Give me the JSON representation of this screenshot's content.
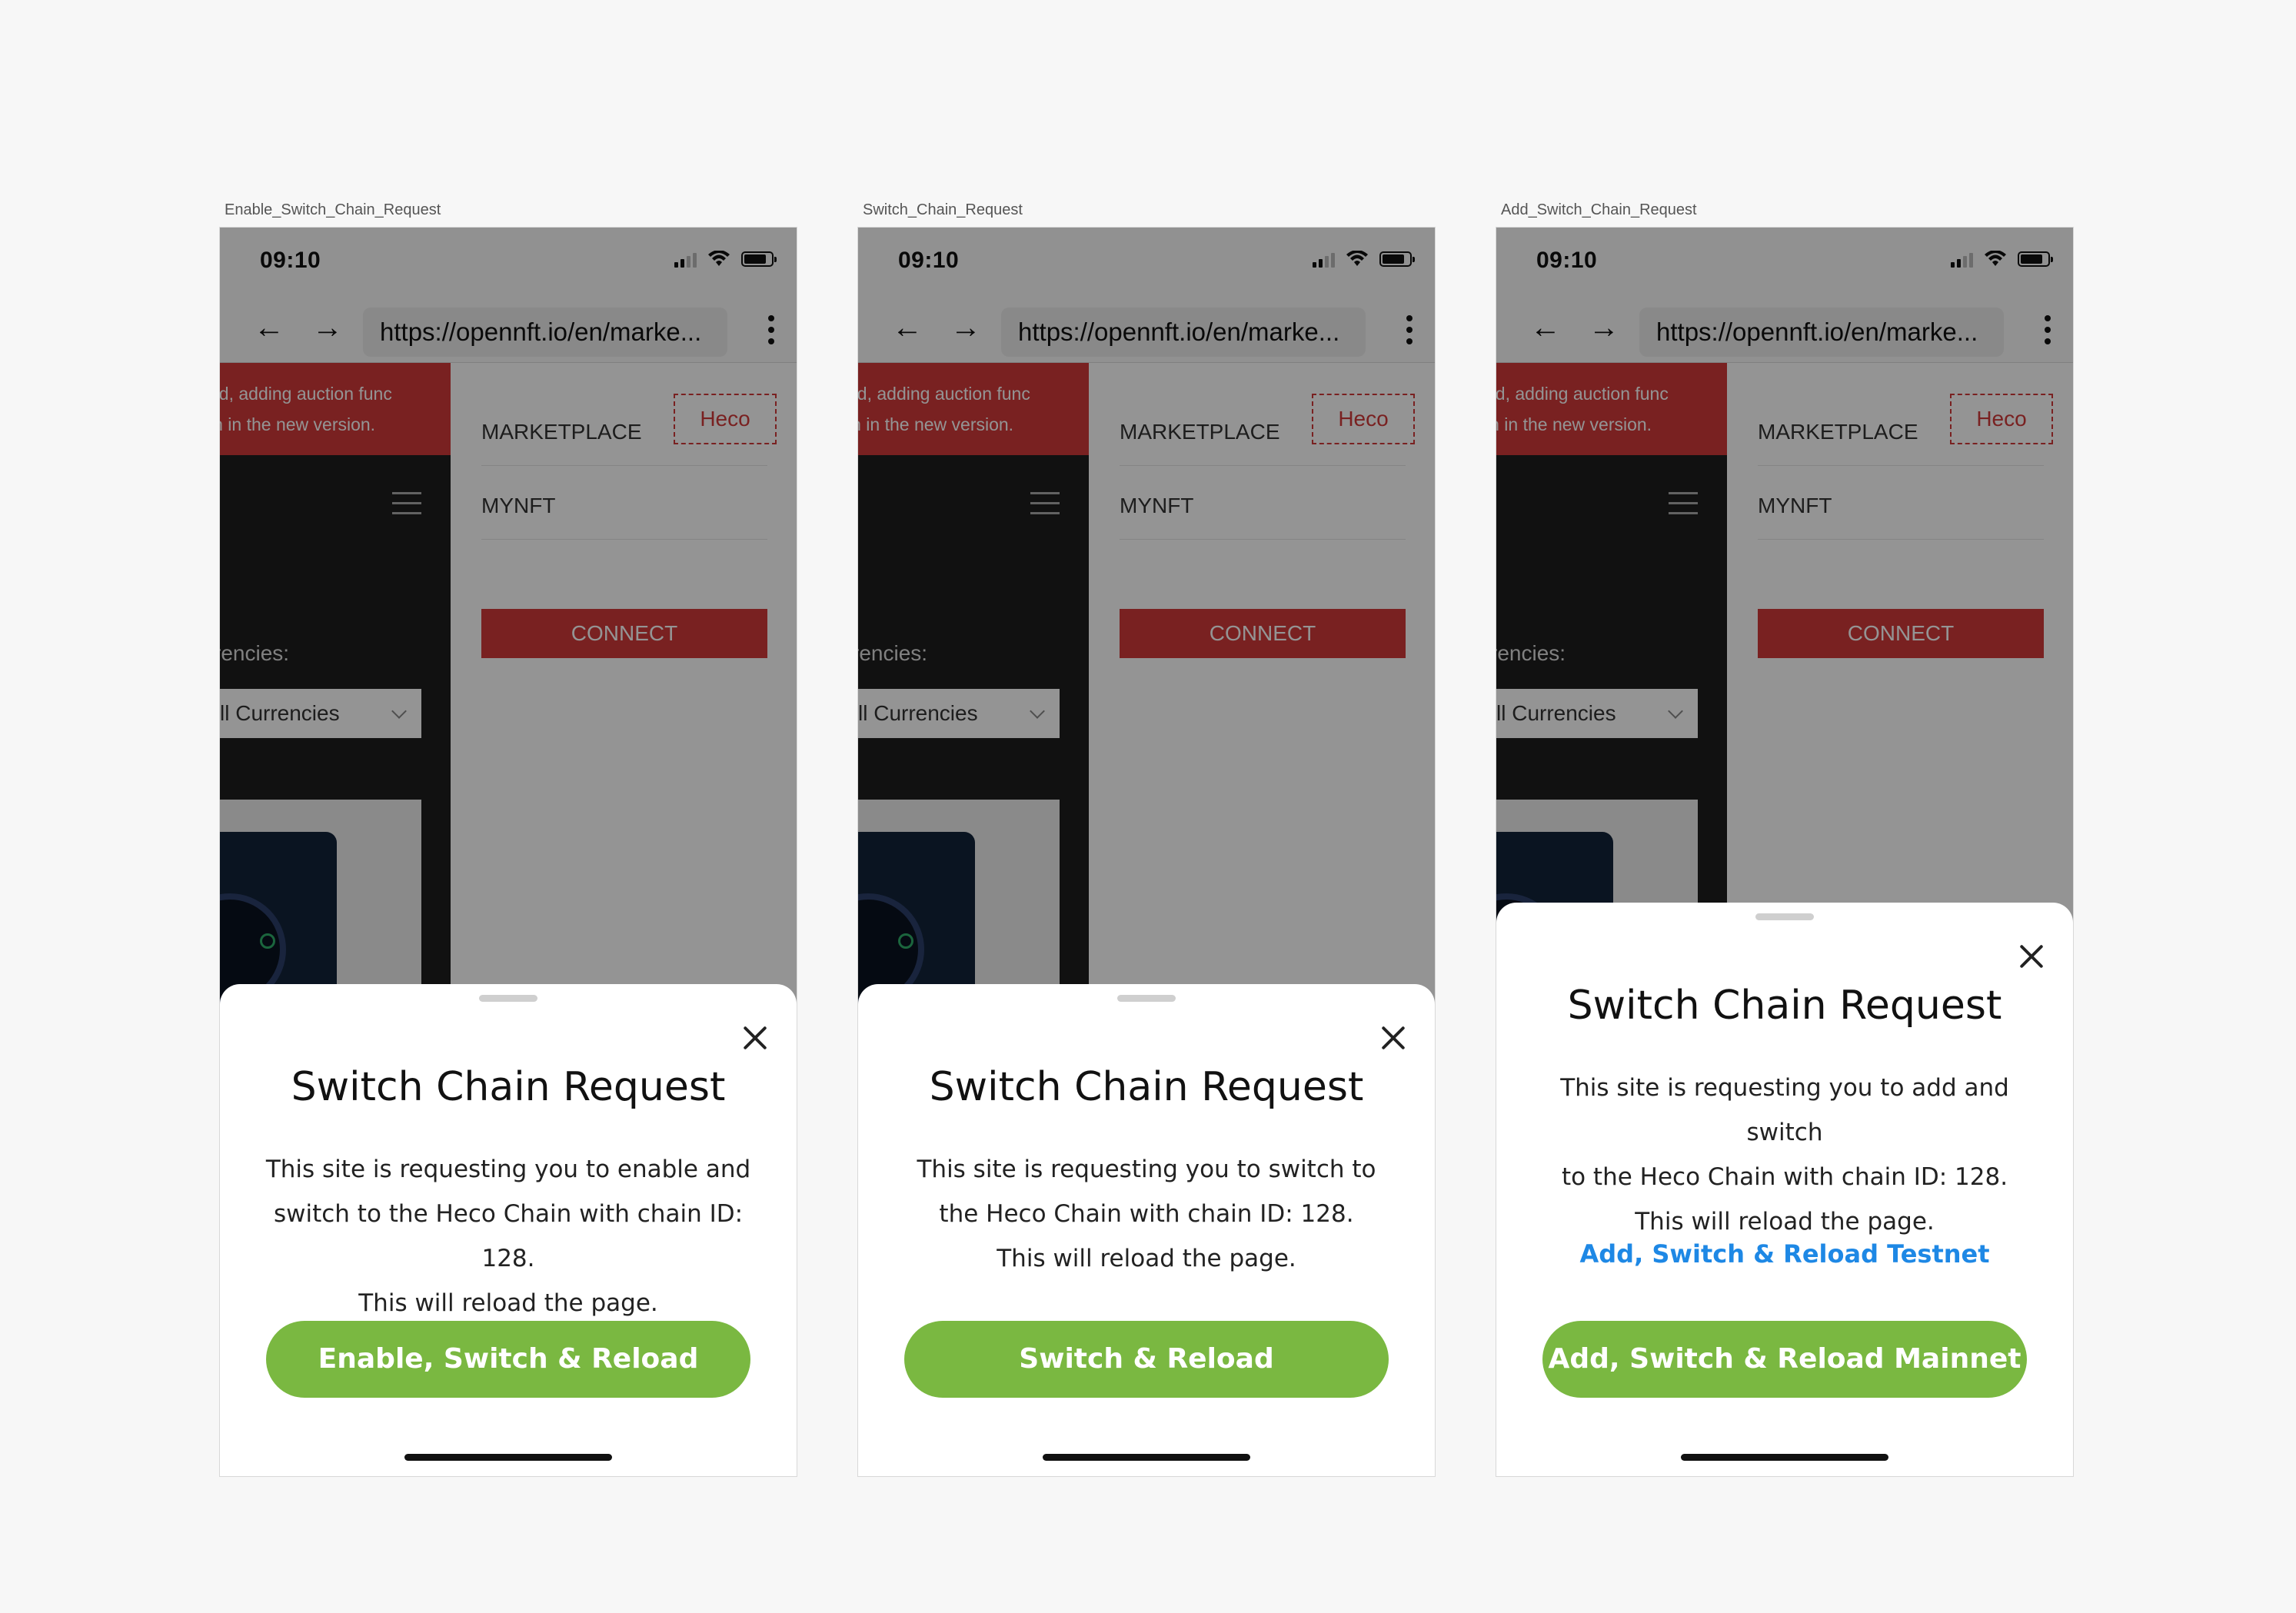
{
  "screens": [
    {
      "frame_label": "Enable_Switch_Chain_Request",
      "status_time": "09:10",
      "url": "https://opennft.io/en/marke...",
      "banner_lines": [
        "ed, adding auction func",
        "in in the new version."
      ],
      "currencies_label": "rencies:",
      "currencies_select": "ll Currencies",
      "network_tag": "Heco",
      "menu": [
        "MARKETPLACE",
        "MYNFT"
      ],
      "connect_label": "CONNECT",
      "sheet": {
        "title": "Switch Chain Request",
        "body": [
          "This site is requesting you to enable and",
          "switch to the Heco Chain with chain ID: 128.",
          "This will reload the page."
        ],
        "secondary_link": "",
        "primary_button": "Enable, Switch & Reload"
      }
    },
    {
      "frame_label": "Switch_Chain_Request",
      "status_time": "09:10",
      "url": "https://opennft.io/en/marke...",
      "banner_lines": [
        "ed, adding auction func",
        "in in the new version."
      ],
      "currencies_label": "rencies:",
      "currencies_select": "ll Currencies",
      "network_tag": "Heco",
      "menu": [
        "MARKETPLACE",
        "MYNFT"
      ],
      "connect_label": "CONNECT",
      "sheet": {
        "title": "Switch Chain Request",
        "body": [
          "This site is requesting you to switch to",
          "the Heco Chain with chain ID: 128.",
          "This will reload the page."
        ],
        "secondary_link": "",
        "primary_button": "Switch & Reload"
      }
    },
    {
      "frame_label": "Add_Switch_Chain_Request",
      "status_time": "09:10",
      "url": "https://opennft.io/en/marke...",
      "banner_lines": [
        "ed, adding auction func",
        "in in the new version."
      ],
      "currencies_label": "rencies:",
      "currencies_select": "ll Currencies",
      "network_tag": "Heco",
      "menu": [
        "MARKETPLACE",
        "MYNFT"
      ],
      "connect_label": "CONNECT",
      "sheet": {
        "title": "Switch Chain Request",
        "body": [
          "This site is requesting you to add and switch",
          "to the Heco Chain with chain ID: 128.",
          "This will reload the page."
        ],
        "secondary_link": "Add, Switch & Reload Testnet",
        "primary_button": "Add, Switch & Reload Mainnet"
      }
    }
  ],
  "colors": {
    "primary_green": "#7ab841",
    "link_blue": "#1e88e5",
    "brand_red": "#d13a3a"
  },
  "icons": {
    "back": "arrow-left-icon",
    "forward": "arrow-right-icon",
    "more": "kebab-menu-icon",
    "close": "close-icon",
    "menu": "hamburger-icon",
    "chevron": "chevron-down-icon",
    "wifi": "wifi-icon",
    "signal": "cellular-signal-icon",
    "battery": "battery-icon"
  }
}
